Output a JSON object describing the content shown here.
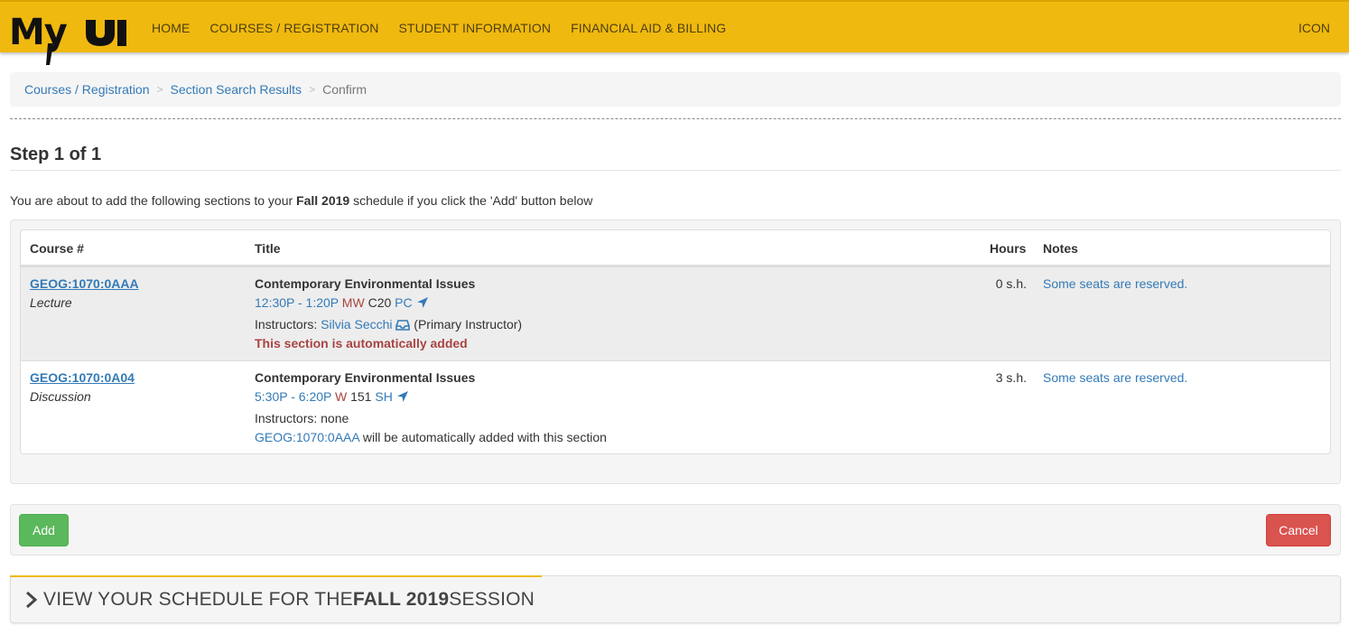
{
  "nav": {
    "logo": "MyUI",
    "items": [
      "HOME",
      "COURSES / REGISTRATION",
      "STUDENT INFORMATION",
      "FINANCIAL AID & BILLING"
    ],
    "right": "ICON"
  },
  "breadcrumb": {
    "items": [
      "Courses / Registration",
      "Section Search Results"
    ],
    "separator": ">",
    "current": "Confirm"
  },
  "step": {
    "title": "Step 1 of 1",
    "intro_before": "You are about to add the following sections to your ",
    "intro_term": "Fall 2019",
    "intro_after": " schedule if you click the 'Add' button below"
  },
  "table": {
    "headers": {
      "course": "Course #",
      "title": "Title",
      "hours": "Hours",
      "notes": "Notes"
    },
    "rows": [
      {
        "course": "GEOG:1070:0AAA",
        "type": "Lecture",
        "title": "Contemporary Environmental Issues",
        "time": "12:30P - 1:20P",
        "days": "MW",
        "room": "C20",
        "building": "PC",
        "instructors_label": "Instructors:",
        "instructor": "Silvia Secchi",
        "instructor_role": "(Primary Instructor)",
        "auto_note": "This section is automatically added",
        "hours": "0 s.h.",
        "notes": "Some seats are reserved."
      },
      {
        "course": "GEOG:1070:0A04",
        "type": "Discussion",
        "title": "Contemporary Environmental Issues",
        "time": "5:30P - 6:20P",
        "days": "W",
        "room": "151",
        "building": "SH",
        "instructors_text": "Instructors: none",
        "linked_course": "GEOG:1070:0AAA",
        "linked_text": " will be automatically added with this section",
        "hours": "3 s.h.",
        "notes": "Some seats are reserved."
      }
    ]
  },
  "actions": {
    "add": "Add",
    "cancel": "Cancel"
  },
  "schedule_panel": {
    "prefix": "VIEW YOUR SCHEDULE FOR THE ",
    "term": "FALL 2019",
    "suffix": " SESSION"
  },
  "colors": {
    "brand_yellow": "#f0b90f",
    "link_blue": "#337ab7",
    "danger_red": "#d9534f",
    "success_green": "#5cb85c"
  }
}
